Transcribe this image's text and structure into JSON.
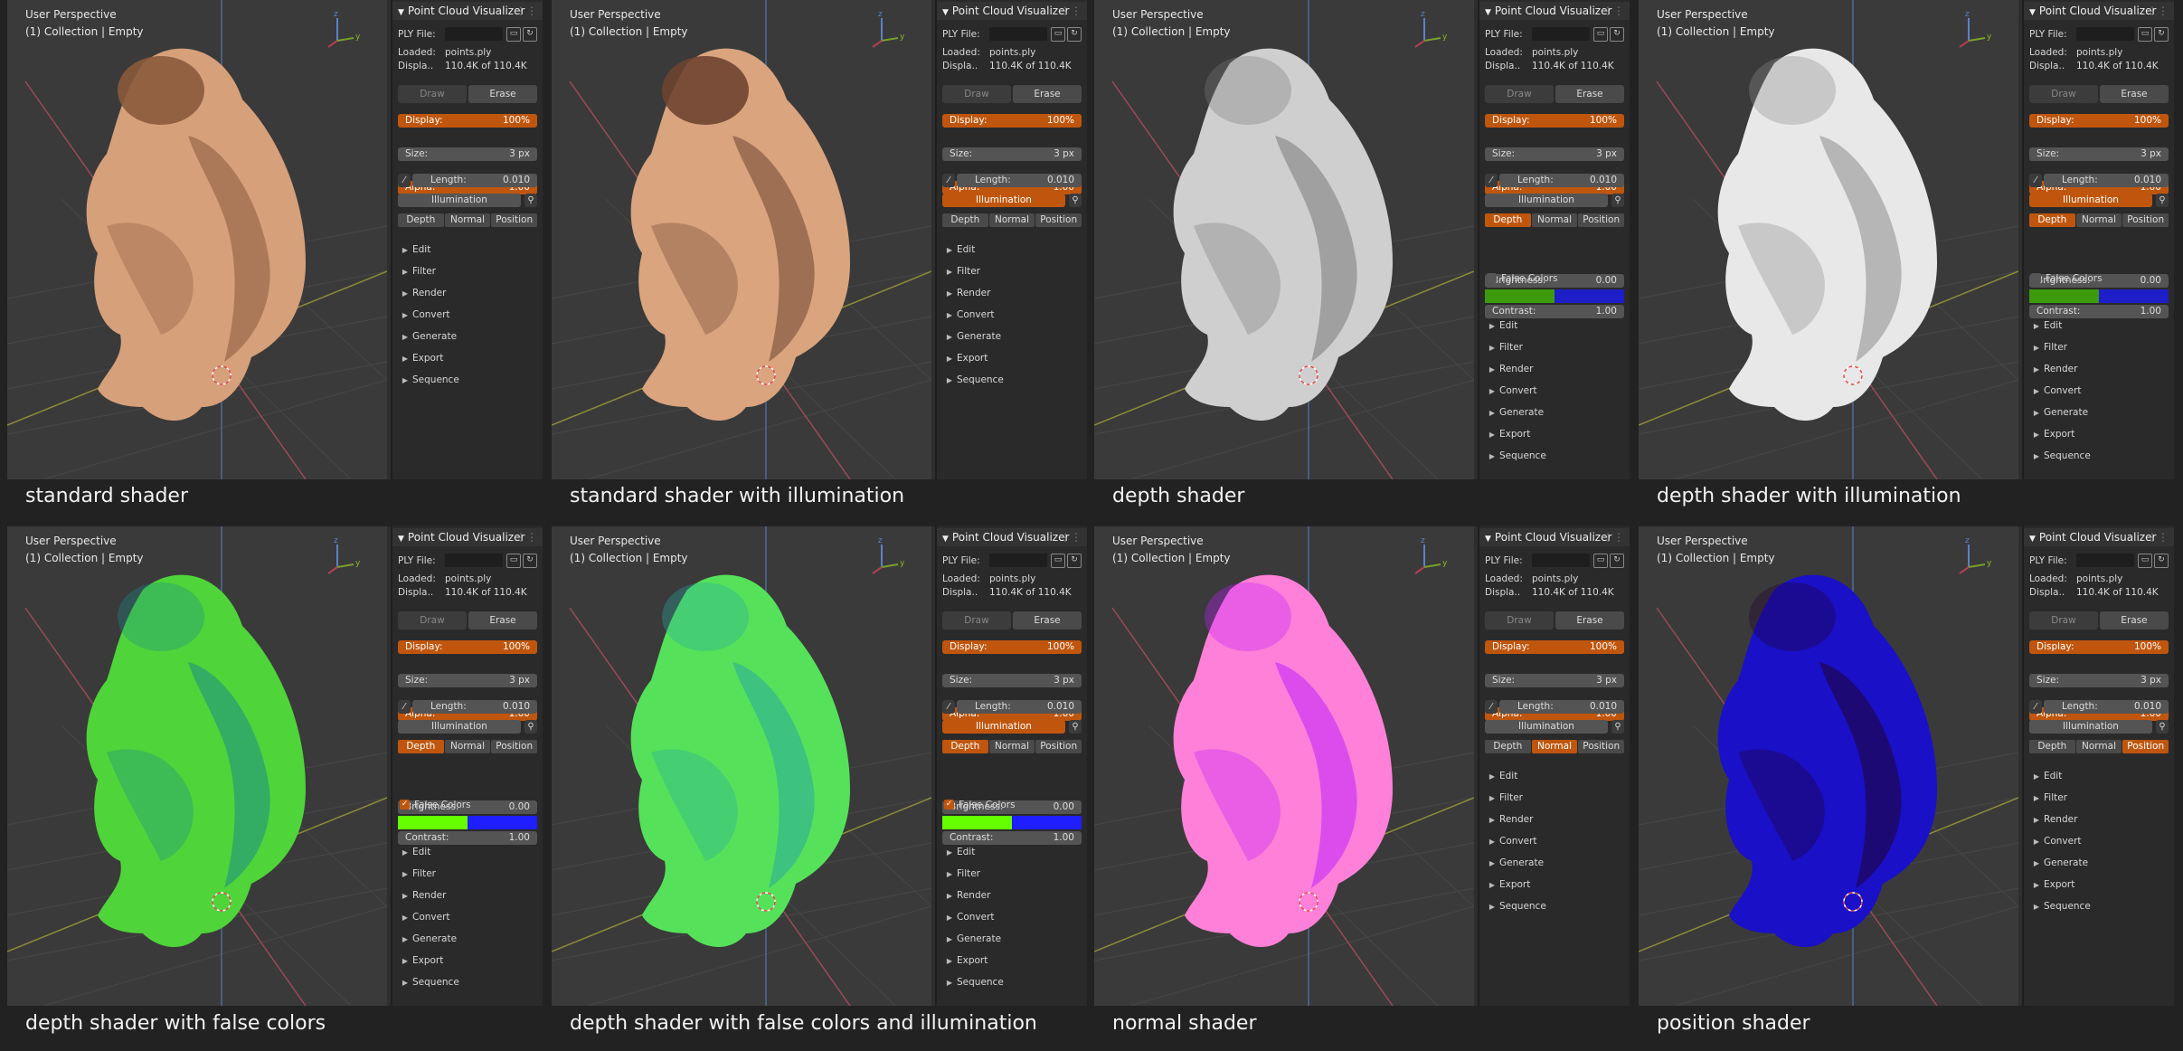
{
  "common": {
    "viewport_title": "User Perspective",
    "viewport_collection": "(1) Collection | Empty",
    "axis_z": "z",
    "axis_y": "y",
    "panel_title": "Point Cloud Visualizer",
    "ply_label": "PLY File:",
    "loaded_label": "Loaded:",
    "loaded_value": "points.ply",
    "display_label": "Displa..",
    "display_value": "110.4K of 110.4K",
    "draw": "Draw",
    "erase": "Erase",
    "display_slider_label": "Display:",
    "display_slider_value": "100%",
    "size_label": "Size:",
    "size_value": "3 px",
    "alpha_label": "Alpha:",
    "alpha_value": "1.00",
    "length_label": "Length:",
    "length_value": "0.010",
    "illumination": "Illumination",
    "tab_depth": "Depth",
    "tab_normal": "Normal",
    "tab_position": "Position",
    "brightness_label": "Brightness:",
    "brightness_value": "0.00",
    "contrast_label": "Contrast:",
    "contrast_value": "1.00",
    "false_colors": "False Colors",
    "menu_items": [
      "Edit",
      "Filter",
      "Render",
      "Convert",
      "Generate",
      "Export",
      "Sequence"
    ]
  },
  "panels": [
    {
      "caption": "standard shader",
      "illumination_on": false,
      "active_tab": "",
      "depth_options": false,
      "false_colors_on": false,
      "colors": {
        "near": "#3c9a0c",
        "far": "#1e1ec8"
      },
      "figure_color": "#d6a07a",
      "figure_shadow": "#8a5a3c"
    },
    {
      "caption": "standard shader with illumination",
      "illumination_on": true,
      "active_tab": "",
      "depth_options": false,
      "false_colors_on": false,
      "colors": {
        "near": "#3c9a0c",
        "far": "#1e1ec8"
      },
      "figure_color": "#d9a47e",
      "figure_shadow": "#6e4430"
    },
    {
      "caption": "depth shader",
      "illumination_on": false,
      "active_tab": "depth",
      "depth_options": true,
      "false_colors_on": false,
      "colors": {
        "near": "#3c9a0c",
        "far": "#1e1ec8"
      },
      "figure_color": "#cfcfcf",
      "figure_shadow": "#7a7a7a"
    },
    {
      "caption": "depth shader with illumination",
      "illumination_on": true,
      "active_tab": "depth",
      "depth_options": true,
      "false_colors_on": false,
      "colors": {
        "near": "#3c9a0c",
        "far": "#1e1ec8"
      },
      "figure_color": "#e8e8e8",
      "figure_shadow": "#8c8c8c"
    },
    {
      "caption": "depth shader with false colors",
      "illumination_on": false,
      "active_tab": "depth",
      "depth_options": true,
      "false_colors_on": true,
      "colors": {
        "near": "#66ff00",
        "far": "#1e1eff"
      },
      "figure_color": "#4fd43a",
      "figure_shadow": "#1d8c86"
    },
    {
      "caption": "depth shader with false colors and illumination",
      "illumination_on": true,
      "active_tab": "depth",
      "depth_options": true,
      "false_colors_on": true,
      "colors": {
        "near": "#66ff00",
        "far": "#1e1eff"
      },
      "figure_color": "#55e25a",
      "figure_shadow": "#2aa8a0"
    },
    {
      "caption": "normal shader",
      "illumination_on": false,
      "active_tab": "normal",
      "depth_options": false,
      "false_colors_on": false,
      "colors": {
        "near": "#3c9a0c",
        "far": "#1e1ec8"
      },
      "figure_color": "#ff80d8",
      "figure_shadow": "#c020ff"
    },
    {
      "caption": "position shader",
      "illumination_on": false,
      "active_tab": "position",
      "depth_options": false,
      "false_colors_on": false,
      "colors": {
        "near": "#3c9a0c",
        "far": "#1e1ec8"
      },
      "figure_color": "#1a10c8",
      "figure_shadow": "#200430"
    }
  ]
}
